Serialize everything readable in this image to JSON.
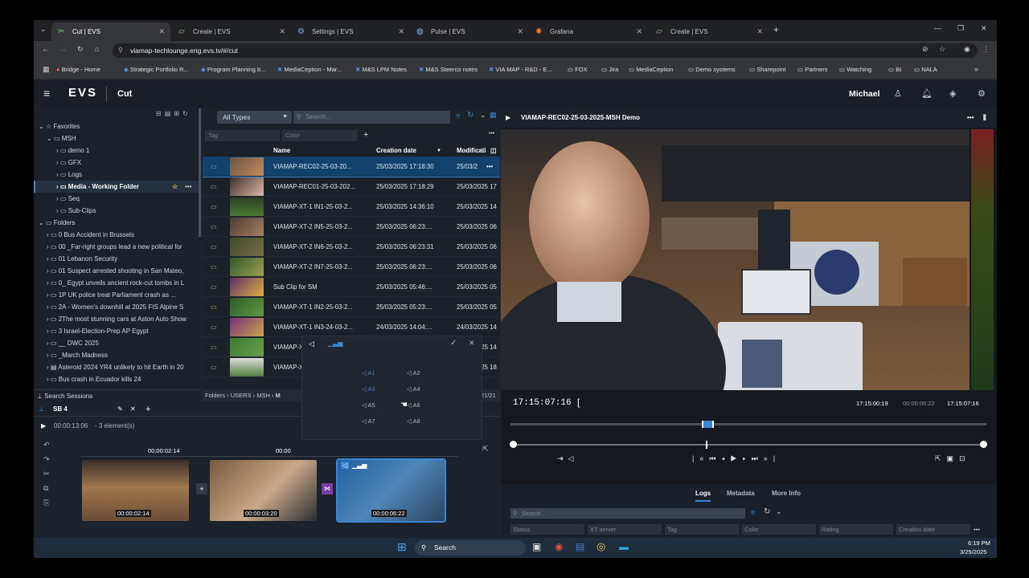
{
  "browser": {
    "tabs": [
      {
        "label": "Cut | EVS",
        "icon": "evs-cut-icon",
        "active": true
      },
      {
        "label": "Create | EVS",
        "icon": "evs-create-icon",
        "active": false
      },
      {
        "label": "Settings | EVS",
        "icon": "gear-icon",
        "active": false
      },
      {
        "label": "Pulse | EVS",
        "icon": "pulse-icon",
        "active": false
      },
      {
        "label": "Grafana",
        "icon": "grafana-icon",
        "active": false
      },
      {
        "label": "Create | EVS",
        "icon": "evs-create-icon",
        "active": false
      }
    ],
    "url": "viamap-techlounge.eng.evs.tv/#/cut",
    "bookmarks": [
      "Bridge - Home",
      "Strategic Portfolio R...",
      "Program Planning b...",
      "MediaCeption - Mar...",
      "M&S LPM Notes",
      "M&S Steerco notes",
      "VIA MAP - R&D - E...",
      "FOX",
      "Jira",
      "MediaCeption",
      "Demo systems",
      "Sharepoint",
      "Partners",
      "Watching",
      "BI",
      "NALA"
    ]
  },
  "app": {
    "logo": "EVS",
    "module": "Cut",
    "user": "Michael"
  },
  "sidebar": {
    "favorites_label": "Favorites",
    "msh_label": "MSH",
    "favorites": [
      "demo 1",
      "GFX",
      "Logs",
      "Media - Working Folder",
      "Seq",
      "Sub-Clips"
    ],
    "folders_label": "Folders",
    "folders": [
      "0 Bus Accident in Brussels",
      "00 _Far-right groups lead a new political for",
      "01 Lebanon Security",
      "01 Suspect arrested shooting in San Mateo,",
      "0_ Egypt unveils ancient rock-cut tombs in L",
      "1P UK police treat Parliament crash as ...",
      "2A - Women's downhill at 2025 FIS Alpine S",
      "2The most stunning cars at Aston Auto Show",
      "3 Israel-Election-Prep AP Egypt",
      "__ DWC 2025",
      "_March Madness",
      "Asteroid 2024 YR4 unlikely to hit Earth in 20",
      "Bus crash in Ecuador kills 24"
    ],
    "search_sessions": "Search Sessions"
  },
  "browser_panel": {
    "type_filter": "All Types",
    "search_placeholder": "Search...",
    "tag_placeholder": "Tag",
    "color_placeholder": "Color",
    "columns": {
      "name": "Name",
      "created": "Creation date",
      "modified": "Modificati"
    },
    "rows": [
      {
        "name": "VIAMAP-REC02-25-03-20...",
        "created": "25/03/2025 17:18:30",
        "modified": "25/03/2"
      },
      {
        "name": "VIAMAP-REC01-25-03-202...",
        "created": "25/03/2025 17:18:29",
        "modified": "25/03/2025 17"
      },
      {
        "name": "VIAMAP-XT-1 IN1-25-03-2...",
        "created": "25/03/2025 14:36:10",
        "modified": "25/03/2025 14"
      },
      {
        "name": "VIAMAP-XT-2 IN5-25-03-2...",
        "created": "25/03/2025 06:23:...",
        "modified": "25/03/2025 06"
      },
      {
        "name": "VIAMAP-XT-2 IN6-25-03-2...",
        "created": "25/03/2025 06:23:31",
        "modified": "25/03/2025 06"
      },
      {
        "name": "VIAMAP-XT-2 IN7-25-03-2...",
        "created": "25/03/2025 06:23:...",
        "modified": "25/03/2025 06"
      },
      {
        "name": "Sub Clip for SM",
        "created": "25/03/2025 05:46:...",
        "modified": "25/03/2025 05"
      },
      {
        "name": "VIAMAP-XT-1 IN2-25-03-2...",
        "created": "25/03/2025 05:23:...",
        "modified": "25/03/2025 05"
      },
      {
        "name": "VIAMAP-XT-1 IN3-24-03-2...",
        "created": "24/03/2025 14:04:...",
        "modified": "24/03/2025 14"
      },
      {
        "name": "VIAMAP-X",
        "created": "",
        "modified": "025 14"
      },
      {
        "name": "VIAMAP-X",
        "created": "",
        "modified": "025 18"
      }
    ],
    "breadcrumb": [
      "Folders",
      "USERS",
      "MSH",
      "M"
    ],
    "count": "21/21"
  },
  "audio_popup": {
    "channels": [
      "A1",
      "A2",
      "A3",
      "A4",
      "A5",
      "A6",
      "A7",
      "A8"
    ]
  },
  "player": {
    "title": "VIAMAP-REC02-25-03-2025-MSH Demo",
    "timecode": "17:15:07:16",
    "in_tc": "17:15:00:19",
    "duration_tc": "00:00:06:22",
    "out_tc": "17:15:07:16",
    "scrub_position": 0.41
  },
  "timeline": {
    "name": "SB 4",
    "duration": "00:00:13:06",
    "elements": "- 3 element(s)",
    "ruler": [
      "00:00:02:14",
      "00:00"
    ],
    "clips": [
      {
        "tc": "00:00:02:14"
      },
      {
        "tc": "00:00:03:20"
      },
      {
        "tc": "00:00:06:22"
      }
    ]
  },
  "logs": {
    "tabs": [
      "Logs",
      "Metadata",
      "More Info"
    ],
    "search_placeholder": "Search...",
    "columns": [
      "Status",
      "XT server",
      "Tag",
      "Color",
      "Rating",
      "Creation date"
    ]
  },
  "taskbar": {
    "search": "Search",
    "time": "6:19 PM",
    "date": "3/25/2025"
  }
}
